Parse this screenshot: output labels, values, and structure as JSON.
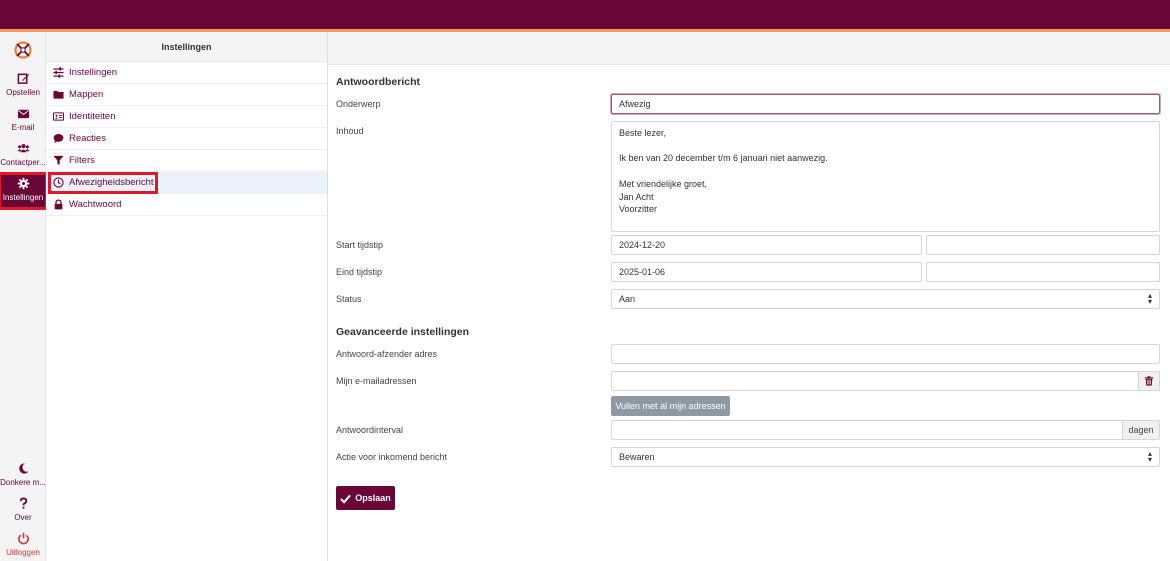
{
  "colors": {
    "brand": "#6a0537",
    "accent": "#f0a254",
    "highlight": "#e0182a",
    "logout": "#d23c3c"
  },
  "rail": {
    "logo_icon": "roundcube-logo-icon",
    "items": [
      {
        "label": "Opstellen",
        "icon": "compose-icon"
      },
      {
        "label": "E-mail",
        "icon": "envelope-icon"
      },
      {
        "label": "Contactper...",
        "icon": "users-icon"
      },
      {
        "label": "Instellingen",
        "icon": "gear-icon"
      }
    ],
    "bottom": [
      {
        "label": "Donkere m...",
        "icon": "moon-icon"
      },
      {
        "label": "Over",
        "icon": "question-icon"
      },
      {
        "label": "Uitloggen",
        "icon": "power-icon"
      }
    ]
  },
  "menu": {
    "title": "Instellingen",
    "items": [
      {
        "label": "Instellingen",
        "icon": "sliders-icon"
      },
      {
        "label": "Mappen",
        "icon": "folder-icon"
      },
      {
        "label": "Identiteiten",
        "icon": "id-card-icon"
      },
      {
        "label": "Reacties",
        "icon": "comment-icon"
      },
      {
        "label": "Filters",
        "icon": "filter-icon"
      },
      {
        "label": "Afwezigheidsbericht",
        "icon": "clock-icon"
      },
      {
        "label": "Wachtwoord",
        "icon": "lock-icon"
      }
    ]
  },
  "form": {
    "section1": "Antwoordbericht",
    "subject_label": "Onderwerp",
    "subject_value": "Afwezig",
    "body_label": "Inhoud",
    "body_value": "Beste lezer,\n\nIk ben van 20 december t/m 6 januari niet aanwezig.\n\nMet vriendelijke groet,\nJan Acht\nVoorzitter",
    "start_label": "Start tijdstip",
    "start_date": "2024-12-20",
    "start_time": "",
    "end_label": "Eind tijdstip",
    "end_date": "2025-01-06",
    "end_time": "",
    "status_label": "Status",
    "status_value": "Aan",
    "section2": "Geavanceerde instellingen",
    "sender_label": "Antwoord-afzender adres",
    "sender_value": "",
    "addresses_label": "Mijn e-mailadressen",
    "addresses_value": "",
    "fill_button": "Vullen met al mijn adressen",
    "interval_label": "Antwoordinterval",
    "interval_value": "",
    "interval_unit": "dagen",
    "action_label": "Actie voor inkomend bericht",
    "action_value": "Bewaren",
    "save_button": "Opslaan"
  }
}
